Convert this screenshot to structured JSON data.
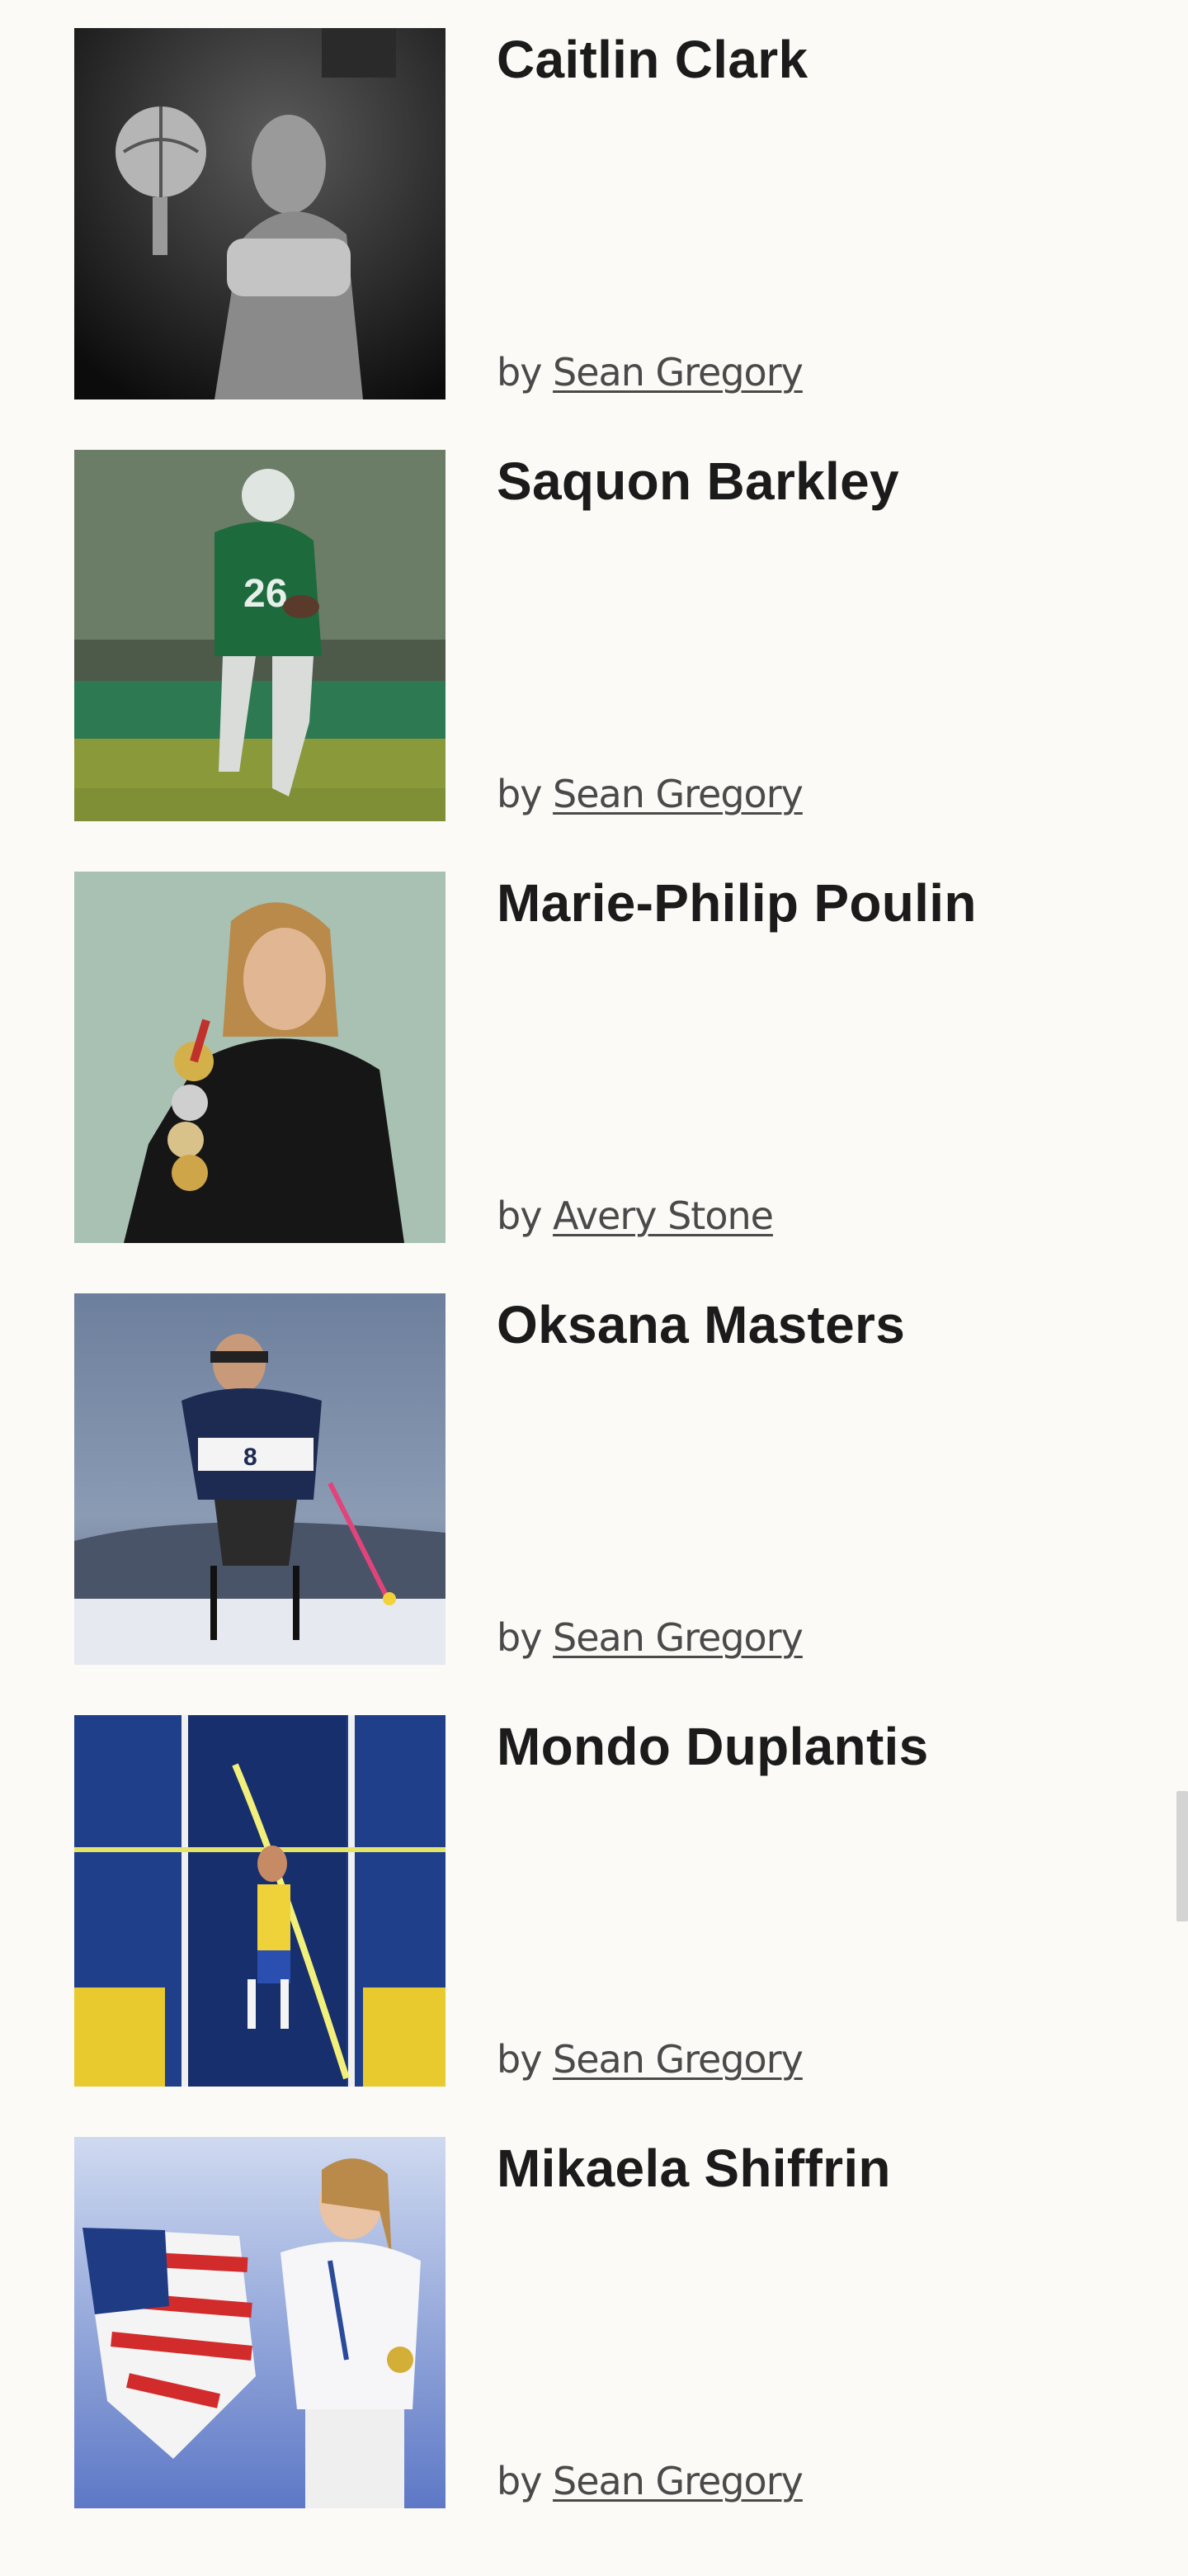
{
  "cards": [
    {
      "name": "Caitlin Clark",
      "by": "by",
      "author": "Sean Gregory",
      "image_icon": "basketball-portrait-photo"
    },
    {
      "name": "Saquon Barkley",
      "by": "by",
      "author": "Sean Gregory",
      "image_icon": "football-player-photo"
    },
    {
      "name": "Marie-Philip Poulin",
      "by": "by",
      "author": "Avery Stone",
      "image_icon": "medals-portrait-photo"
    },
    {
      "name": "Oksana Masters",
      "by": "by",
      "author": "Sean Gregory",
      "image_icon": "sit-ski-photo"
    },
    {
      "name": "Mondo Duplantis",
      "by": "by",
      "author": "Sean Gregory",
      "image_icon": "pole-vault-photo"
    },
    {
      "name": "Mikaela Shiffrin",
      "by": "by",
      "author": "Sean Gregory",
      "image_icon": "flag-celebration-photo"
    }
  ],
  "colors": {
    "background": "#fcfaf6",
    "title": "#1b1b1b",
    "byline": "#4a4a4a"
  }
}
